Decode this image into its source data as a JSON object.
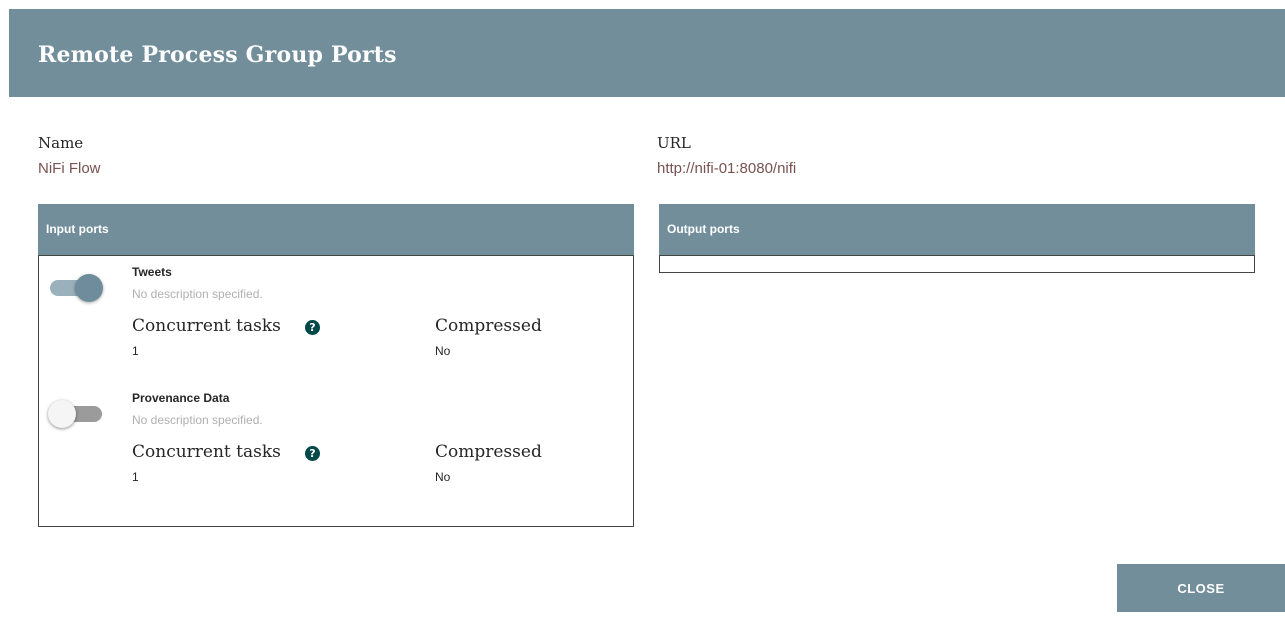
{
  "dialog": {
    "title": "Remote Process Group Ports",
    "name_label": "Name",
    "name_value": "NiFi Flow",
    "url_label": "URL",
    "url_value": "http://nifi-01:8080/nifi",
    "close_label": "CLOSE"
  },
  "input_ports": {
    "header": "Input ports",
    "items": [
      {
        "name": "Tweets",
        "description": "No description specified.",
        "enabled": true,
        "concurrent_label": "Concurrent tasks",
        "concurrent_value": "1",
        "compressed_label": "Compressed",
        "compressed_value": "No"
      },
      {
        "name": "Provenance Data",
        "description": "No description specified.",
        "enabled": false,
        "concurrent_label": "Concurrent tasks",
        "concurrent_value": "1",
        "compressed_label": "Compressed",
        "compressed_value": "No"
      }
    ]
  },
  "output_ports": {
    "header": "Output ports",
    "items": []
  },
  "icons": {
    "help": "question-circle-icon"
  },
  "colors": {
    "header_bg": "#728e9b",
    "value_text": "#775351",
    "toggle_on": "#6e8c9c",
    "help_icon": "#004849"
  }
}
